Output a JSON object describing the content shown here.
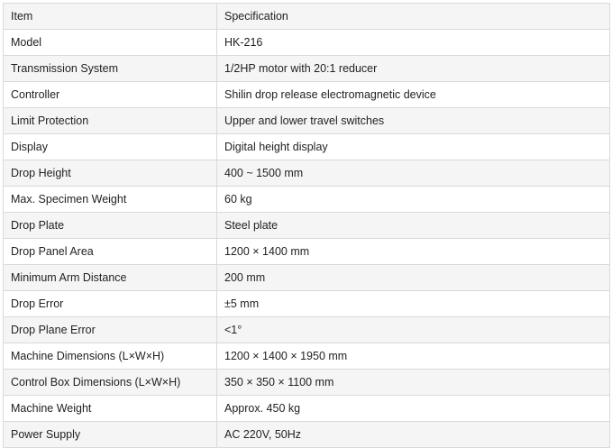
{
  "table": {
    "header": {
      "item": "Item",
      "specification": "Specification"
    },
    "rows": [
      {
        "item": "Model",
        "value": "HK-216"
      },
      {
        "item": "Transmission System",
        "value": "1/2HP motor with 20:1 reducer"
      },
      {
        "item": "Controller",
        "value": "Shilin drop release electromagnetic device"
      },
      {
        "item": "Limit Protection",
        "value": "Upper and lower travel switches"
      },
      {
        "item": "Display",
        "value": "Digital height display"
      },
      {
        "item": "Drop Height",
        "value": "400 ~ 1500 mm"
      },
      {
        "item": "Max. Specimen Weight",
        "value": "60 kg"
      },
      {
        "item": "Drop Plate",
        "value": "Steel plate"
      },
      {
        "item": "Drop Panel Area",
        "value": "1200 × 1400 mm"
      },
      {
        "item": "Minimum Arm Distance",
        "value": "200 mm"
      },
      {
        "item": "Drop Error",
        "value": "±5 mm"
      },
      {
        "item": "Drop Plane Error",
        "value": "<1°"
      },
      {
        "item": "Machine Dimensions (L×W×H)",
        "value": "1200 × 1400 × 1950 mm"
      },
      {
        "item": "Control Box Dimensions (L×W×H)",
        "value": "350 × 350 × 1100 mm"
      },
      {
        "item": "Machine Weight",
        "value": "Approx. 450 kg"
      },
      {
        "item": "Power Supply",
        "value": "AC 220V, 50Hz"
      }
    ]
  }
}
